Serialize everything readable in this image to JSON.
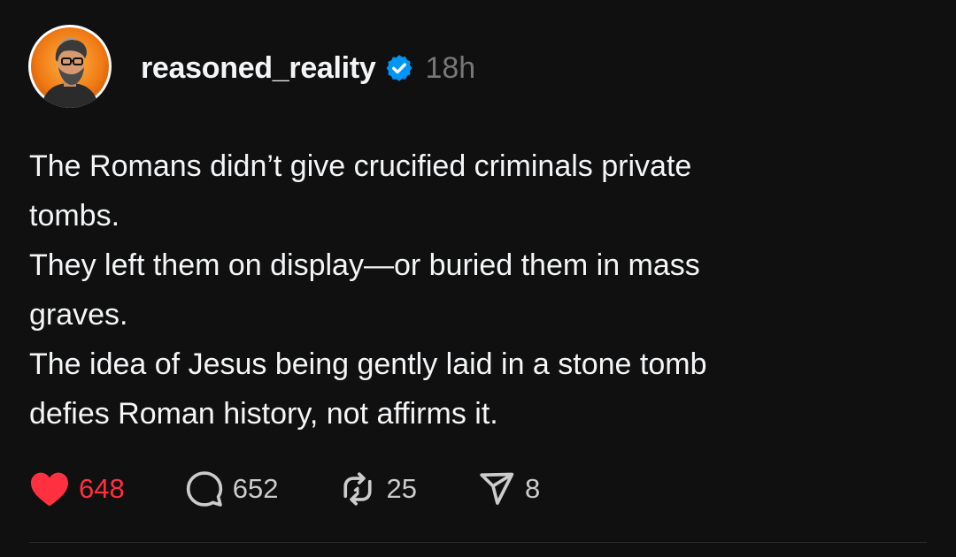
{
  "post": {
    "username": "reasoned_reality",
    "timestamp": "18h",
    "verified": true,
    "lines": [
      "The Romans didn’t give crucified criminals private\ntombs.",
      "They left them on display—or buried them in mass\ngraves.",
      "The idea of Jesus being gently laid in a stone tomb\ndefies Roman history, not affirms it."
    ]
  },
  "actions": {
    "likes": "648",
    "replies": "652",
    "reposts": "25",
    "shares": "8"
  },
  "icons": {
    "like": "heart-icon",
    "reply": "comment-bubble-icon",
    "repost": "repost-icon",
    "share": "send-icon",
    "verified": "verified-badge-icon"
  },
  "colors": {
    "background": "#101010",
    "text": "#f3f5f7",
    "muted": "#777777",
    "like_red": "#ff3040",
    "verified_blue": "#0095f6",
    "avatar_orange": "#f08a1c"
  }
}
